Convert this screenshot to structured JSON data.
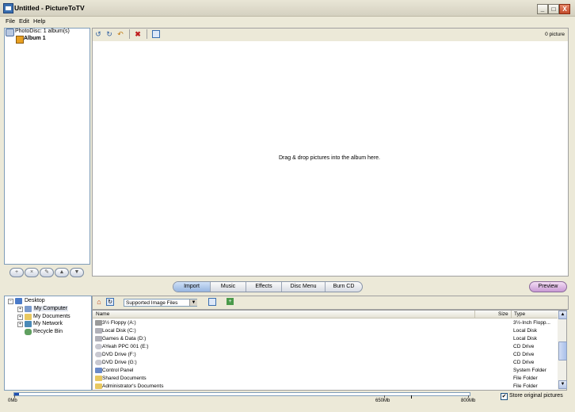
{
  "window": {
    "title": "Untitled - PictureToTV",
    "minimize": "_",
    "maximize": "□",
    "close": "X"
  },
  "menu": {
    "file": "File",
    "edit": "Edit",
    "help": "Help"
  },
  "album_tree": {
    "root": "PhotoDisc: 1 album(s)",
    "album": "Album 1"
  },
  "album_buttons": [
    "+",
    "×",
    "✎",
    "▲",
    "▼"
  ],
  "picture_panel": {
    "count": "0 picture",
    "drop_hint": "Drag & drop pictures into the album here."
  },
  "tabs": [
    "Import",
    "Music",
    "Effects",
    "Disc Menu",
    "Burn CD"
  ],
  "active_tab": "Import",
  "preview_button": "Preview",
  "folder_tree": {
    "desktop": "Desktop",
    "items": [
      "My Computer",
      "My Documents",
      "My Network",
      "Recycle Bin"
    ]
  },
  "file_browser": {
    "filter": "Supported Image Files",
    "columns": {
      "name": "Name",
      "size": "Size",
      "type": "Type"
    },
    "rows": [
      {
        "name": "3½ Floppy (A:)",
        "type": "3½-Inch Flopp...",
        "icon": "floppy-icon"
      },
      {
        "name": "Local Disk (C:)",
        "type": "Local Disk",
        "icon": "hard-disk-icon"
      },
      {
        "name": "Games & Data (D:)",
        "type": "Local Disk",
        "icon": "hard-disk-icon"
      },
      {
        "name": "AYeah PPC 001 (E:)",
        "type": "CD Drive",
        "icon": "cd-drive-icon"
      },
      {
        "name": "DVD Drive (F:)",
        "type": "CD Drive",
        "icon": "cd-drive-icon"
      },
      {
        "name": "DVD Drive (G:)",
        "type": "CD Drive",
        "icon": "cd-drive-icon"
      },
      {
        "name": "Control Panel",
        "type": "System Folder",
        "icon": "control-panel-icon"
      },
      {
        "name": "Shared Documents",
        "type": "File Folder",
        "icon": "folder-icon"
      },
      {
        "name": "Administrator's Documents",
        "type": "File Folder",
        "icon": "folder-icon"
      }
    ]
  },
  "capacity": {
    "min_label": "0Mb",
    "mark1_label": "650Mb",
    "max_label": "800Mb",
    "used_fraction": 0.01
  },
  "store_original": {
    "label": "Store original pictures",
    "checked": true
  },
  "colors": {
    "tab_active": "#98b6e0",
    "preview": "#c89ad4",
    "capacity_fill": "#2050b0"
  }
}
